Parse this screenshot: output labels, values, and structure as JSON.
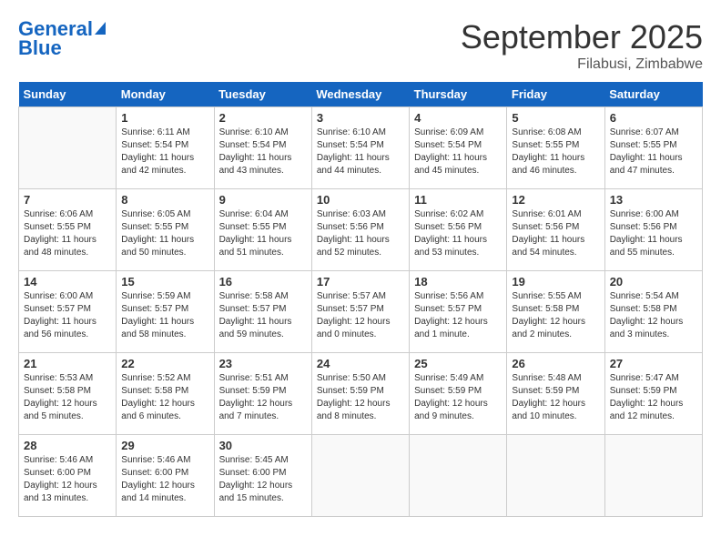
{
  "header": {
    "logo_line1": "General",
    "logo_line2": "Blue",
    "month": "September 2025",
    "location": "Filabusi, Zimbabwe"
  },
  "days_of_week": [
    "Sunday",
    "Monday",
    "Tuesday",
    "Wednesday",
    "Thursday",
    "Friday",
    "Saturday"
  ],
  "weeks": [
    [
      {
        "day": "",
        "info": ""
      },
      {
        "day": "1",
        "info": "Sunrise: 6:11 AM\nSunset: 5:54 PM\nDaylight: 11 hours\nand 42 minutes."
      },
      {
        "day": "2",
        "info": "Sunrise: 6:10 AM\nSunset: 5:54 PM\nDaylight: 11 hours\nand 43 minutes."
      },
      {
        "day": "3",
        "info": "Sunrise: 6:10 AM\nSunset: 5:54 PM\nDaylight: 11 hours\nand 44 minutes."
      },
      {
        "day": "4",
        "info": "Sunrise: 6:09 AM\nSunset: 5:54 PM\nDaylight: 11 hours\nand 45 minutes."
      },
      {
        "day": "5",
        "info": "Sunrise: 6:08 AM\nSunset: 5:55 PM\nDaylight: 11 hours\nand 46 minutes."
      },
      {
        "day": "6",
        "info": "Sunrise: 6:07 AM\nSunset: 5:55 PM\nDaylight: 11 hours\nand 47 minutes."
      }
    ],
    [
      {
        "day": "7",
        "info": "Sunrise: 6:06 AM\nSunset: 5:55 PM\nDaylight: 11 hours\nand 48 minutes."
      },
      {
        "day": "8",
        "info": "Sunrise: 6:05 AM\nSunset: 5:55 PM\nDaylight: 11 hours\nand 50 minutes."
      },
      {
        "day": "9",
        "info": "Sunrise: 6:04 AM\nSunset: 5:55 PM\nDaylight: 11 hours\nand 51 minutes."
      },
      {
        "day": "10",
        "info": "Sunrise: 6:03 AM\nSunset: 5:56 PM\nDaylight: 11 hours\nand 52 minutes."
      },
      {
        "day": "11",
        "info": "Sunrise: 6:02 AM\nSunset: 5:56 PM\nDaylight: 11 hours\nand 53 minutes."
      },
      {
        "day": "12",
        "info": "Sunrise: 6:01 AM\nSunset: 5:56 PM\nDaylight: 11 hours\nand 54 minutes."
      },
      {
        "day": "13",
        "info": "Sunrise: 6:00 AM\nSunset: 5:56 PM\nDaylight: 11 hours\nand 55 minutes."
      }
    ],
    [
      {
        "day": "14",
        "info": "Sunrise: 6:00 AM\nSunset: 5:57 PM\nDaylight: 11 hours\nand 56 minutes."
      },
      {
        "day": "15",
        "info": "Sunrise: 5:59 AM\nSunset: 5:57 PM\nDaylight: 11 hours\nand 58 minutes."
      },
      {
        "day": "16",
        "info": "Sunrise: 5:58 AM\nSunset: 5:57 PM\nDaylight: 11 hours\nand 59 minutes."
      },
      {
        "day": "17",
        "info": "Sunrise: 5:57 AM\nSunset: 5:57 PM\nDaylight: 12 hours\nand 0 minutes."
      },
      {
        "day": "18",
        "info": "Sunrise: 5:56 AM\nSunset: 5:57 PM\nDaylight: 12 hours\nand 1 minute."
      },
      {
        "day": "19",
        "info": "Sunrise: 5:55 AM\nSunset: 5:58 PM\nDaylight: 12 hours\nand 2 minutes."
      },
      {
        "day": "20",
        "info": "Sunrise: 5:54 AM\nSunset: 5:58 PM\nDaylight: 12 hours\nand 3 minutes."
      }
    ],
    [
      {
        "day": "21",
        "info": "Sunrise: 5:53 AM\nSunset: 5:58 PM\nDaylight: 12 hours\nand 5 minutes."
      },
      {
        "day": "22",
        "info": "Sunrise: 5:52 AM\nSunset: 5:58 PM\nDaylight: 12 hours\nand 6 minutes."
      },
      {
        "day": "23",
        "info": "Sunrise: 5:51 AM\nSunset: 5:59 PM\nDaylight: 12 hours\nand 7 minutes."
      },
      {
        "day": "24",
        "info": "Sunrise: 5:50 AM\nSunset: 5:59 PM\nDaylight: 12 hours\nand 8 minutes."
      },
      {
        "day": "25",
        "info": "Sunrise: 5:49 AM\nSunset: 5:59 PM\nDaylight: 12 hours\nand 9 minutes."
      },
      {
        "day": "26",
        "info": "Sunrise: 5:48 AM\nSunset: 5:59 PM\nDaylight: 12 hours\nand 10 minutes."
      },
      {
        "day": "27",
        "info": "Sunrise: 5:47 AM\nSunset: 5:59 PM\nDaylight: 12 hours\nand 12 minutes."
      }
    ],
    [
      {
        "day": "28",
        "info": "Sunrise: 5:46 AM\nSunset: 6:00 PM\nDaylight: 12 hours\nand 13 minutes."
      },
      {
        "day": "29",
        "info": "Sunrise: 5:46 AM\nSunset: 6:00 PM\nDaylight: 12 hours\nand 14 minutes."
      },
      {
        "day": "30",
        "info": "Sunrise: 5:45 AM\nSunset: 6:00 PM\nDaylight: 12 hours\nand 15 minutes."
      },
      {
        "day": "",
        "info": ""
      },
      {
        "day": "",
        "info": ""
      },
      {
        "day": "",
        "info": ""
      },
      {
        "day": "",
        "info": ""
      }
    ]
  ]
}
